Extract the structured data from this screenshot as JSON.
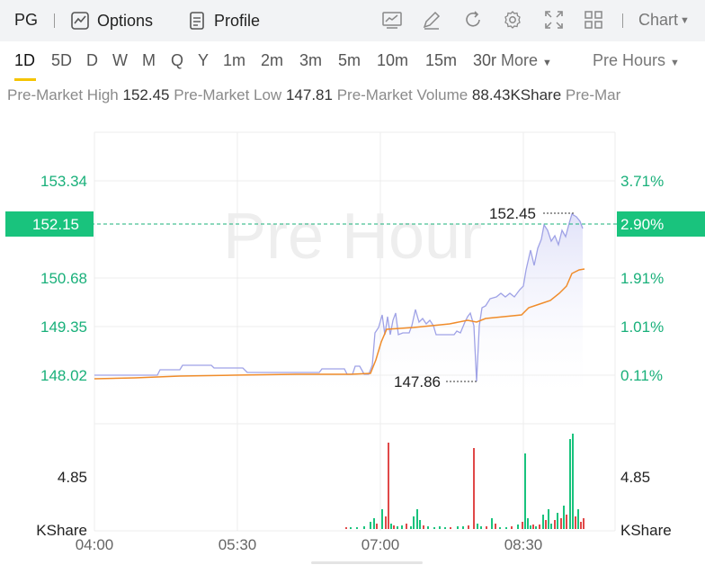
{
  "topbar": {
    "symbol": "PG",
    "options_label": "Options",
    "profile_label": "Profile",
    "chart_menu_label": "Chart"
  },
  "periods": {
    "items": [
      "1D",
      "5D",
      "D",
      "W",
      "M",
      "Q",
      "Y",
      "1m",
      "2m",
      "3m",
      "5m",
      "10m",
      "15m",
      "30r"
    ],
    "more_label": "More",
    "session_label": "Pre Hours",
    "active": "1D"
  },
  "stats": {
    "high_label": "Pre-Market High",
    "high_value": "152.45",
    "low_label": "Pre-Market Low",
    "low_value": "147.81",
    "volume_label": "Pre-Market Volume",
    "volume_value": "88.43KShare",
    "trailing_label": "Pre-Mar"
  },
  "chart_data": {
    "type": "line",
    "watermark": "Pre Hour",
    "x_ticks": [
      "04:00",
      "05:30",
      "07:00",
      "08:30"
    ],
    "price_ticks": [
      "153.34",
      "150.68",
      "149.35",
      "148.02"
    ],
    "percent_ticks": [
      "3.71%",
      "1.91%",
      "1.01%",
      "0.11%"
    ],
    "current_price": "152.15",
    "current_percent": "2.90%",
    "high_annotation": "152.45",
    "low_annotation": "147.86",
    "volume_tick": "4.85",
    "volume_unit": "KShare",
    "colors": {
      "up": "#19c37d",
      "down": "#e04848",
      "price_line": "#9fa2e6",
      "avg_line": "#f08c2a"
    }
  }
}
